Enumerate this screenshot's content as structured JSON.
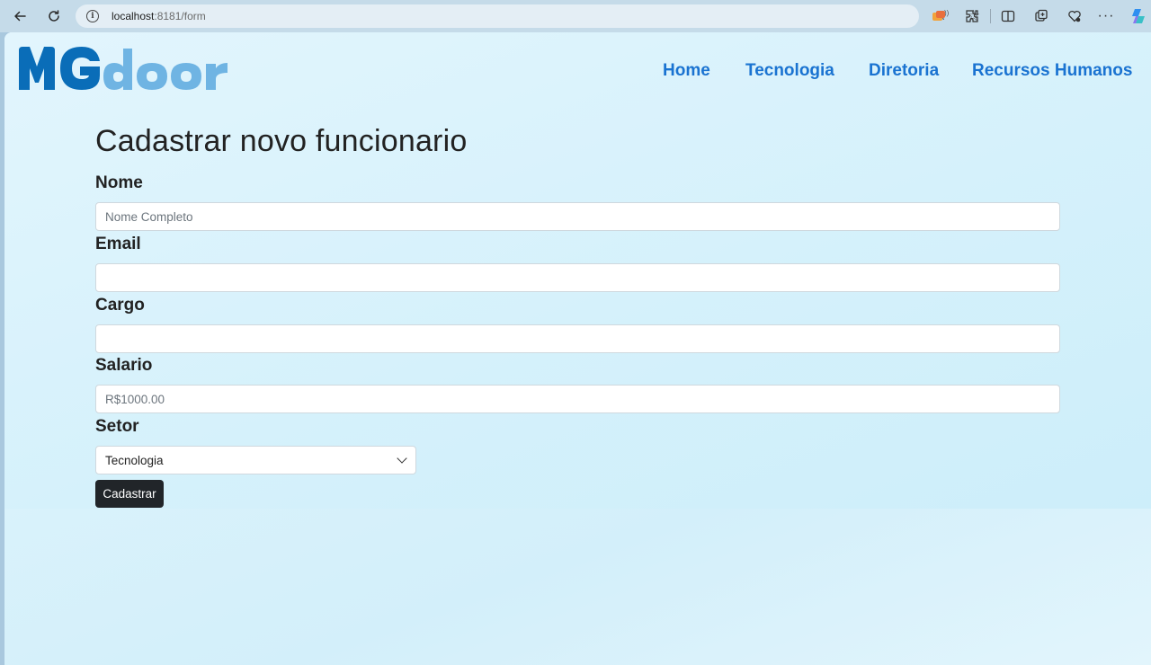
{
  "browser": {
    "url_host": "localhost",
    "url_rest": ":8181/form"
  },
  "header": {
    "logo_text": "MGdoor",
    "nav": [
      {
        "label": "Home"
      },
      {
        "label": "Tecnologia"
      },
      {
        "label": "Diretoria"
      },
      {
        "label": "Recursos Humanos"
      }
    ],
    "logo_colors": {
      "mg": "#0a6db8",
      "door": "#6fb4e3"
    },
    "link_color": "#1a73d1"
  },
  "form": {
    "title": "Cadastrar novo funcionario",
    "fields": {
      "nome": {
        "label": "Nome",
        "placeholder": "Nome Completo",
        "value": ""
      },
      "email": {
        "label": "Email",
        "placeholder": "",
        "value": ""
      },
      "cargo": {
        "label": "Cargo",
        "placeholder": "",
        "value": ""
      },
      "salario": {
        "label": "Salario",
        "placeholder": "R$1000.00",
        "value": ""
      },
      "setor": {
        "label": "Setor",
        "selected": "Tecnologia"
      }
    },
    "submit_label": "Cadastrar"
  }
}
